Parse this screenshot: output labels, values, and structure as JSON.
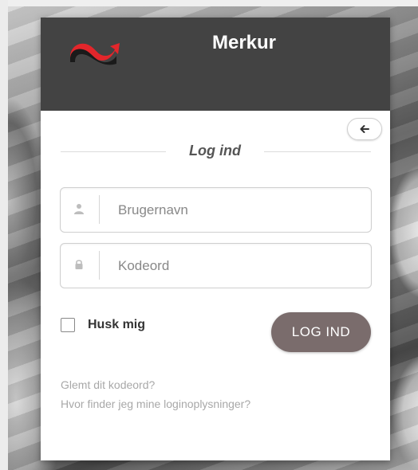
{
  "header": {
    "title": "Merkur",
    "logo": "merkur-logo-icon"
  },
  "login": {
    "back_icon": "arrow-left-icon",
    "section_title": "Log ind",
    "username": {
      "placeholder": "Brugernavn",
      "value": "",
      "icon": "user-icon"
    },
    "password": {
      "placeholder": "Kodeord",
      "value": "",
      "icon": "lock-icon"
    },
    "remember_label": "Husk mig",
    "remember_checked": false,
    "submit_label": "LOG IND",
    "forgot_link": "Glemt dit kodeord?",
    "help_link": "Hvor finder jeg mine loginoplysninger?"
  },
  "colors": {
    "header_bg": "#434343",
    "button_bg": "#7a6c6c",
    "logo_red": "#e3262b",
    "link_gray": "#a8a8a8"
  }
}
